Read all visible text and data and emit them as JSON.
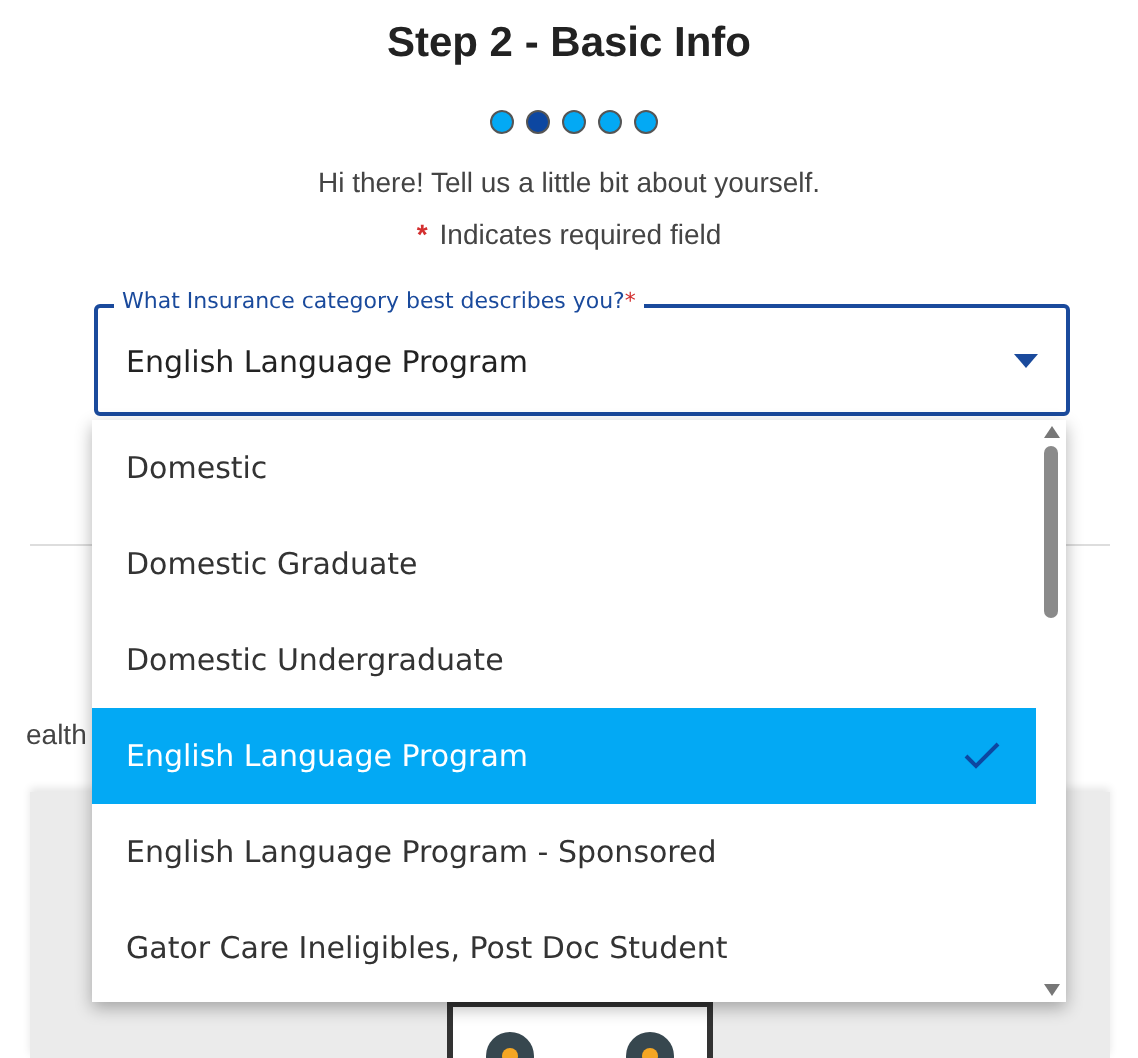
{
  "title": "Step 2 - Basic Info",
  "steps": [
    {
      "selected": false
    },
    {
      "selected": true
    },
    {
      "selected": false
    },
    {
      "selected": false
    },
    {
      "selected": false
    }
  ],
  "intro": "Hi there! Tell us a little bit about yourself.",
  "required_note": {
    "mark": "*",
    "text": "Indicates required field"
  },
  "field": {
    "label": "What Insurance category best describes you?",
    "required_mark": "*",
    "value": "English Language Program",
    "expanded": true
  },
  "options": [
    {
      "label": "Domestic",
      "selected": false
    },
    {
      "label": "Domestic Graduate",
      "selected": false
    },
    {
      "label": "Domestic Undergraduate",
      "selected": false
    },
    {
      "label": "English Language Program",
      "selected": true
    },
    {
      "label": "English Language Program - Sponsored",
      "selected": false
    },
    {
      "label": "Gator Care Ineligibles, Post Doc Student",
      "selected": false
    }
  ],
  "background_text": "ealth"
}
